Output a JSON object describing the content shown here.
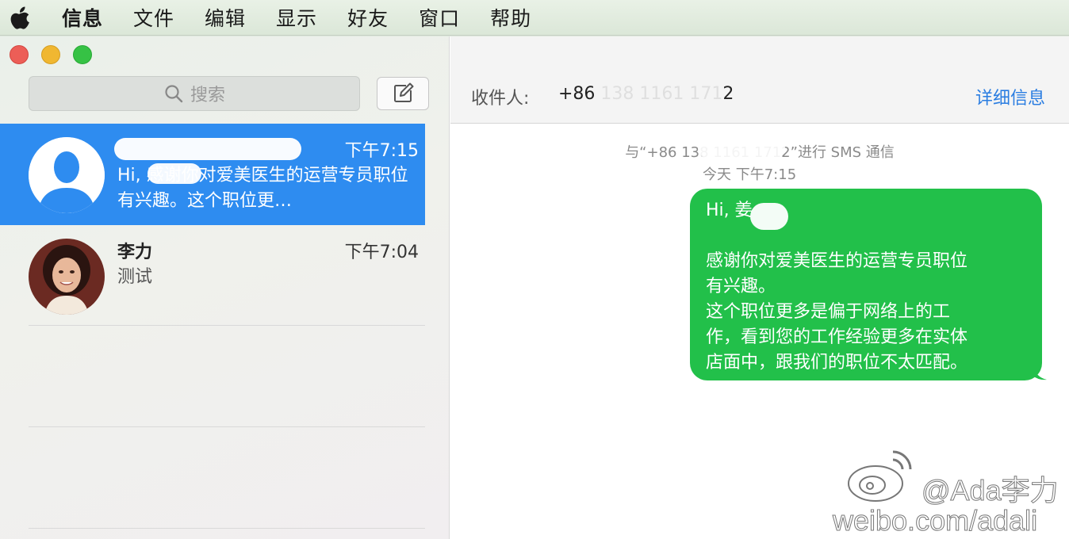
{
  "menubar": {
    "app": "信息",
    "items": [
      "文件",
      "编辑",
      "显示",
      "好友",
      "窗口",
      "帮助"
    ]
  },
  "sidebar": {
    "search_placeholder": "搜索",
    "conversations": [
      {
        "name": "",
        "time": "下午7:15",
        "preview": "Hi,       感谢你对爱美医生的运营专员职位有兴趣。这个职位更…",
        "selected": true
      },
      {
        "name": "李力",
        "time": "下午7:04",
        "preview": "测试",
        "selected": false
      }
    ]
  },
  "header": {
    "to_label": "收件人:",
    "to_value": "+86 138  1161 1712",
    "details_label": "详细信息"
  },
  "thread": {
    "sms_note": "与“+86 138  1161 1712”进行 SMS 通信",
    "timestamp": "今天 下午7:15",
    "message_lines": [
      "Hi, 姜",
      "",
      "感谢你对爱美医生的运营专员职位",
      "有兴趣。",
      "这个职位更多是偏于网络上的工",
      "作，看到您的工作经验更多在实体",
      "店面中，跟我们的职位不太匹配。"
    ]
  },
  "watermark": {
    "handle": "@Ada李力",
    "url": "weibo.com/adali"
  },
  "colors": {
    "selection": "#2e8cf0",
    "bubble": "#22c04a",
    "link": "#2a7de1"
  }
}
